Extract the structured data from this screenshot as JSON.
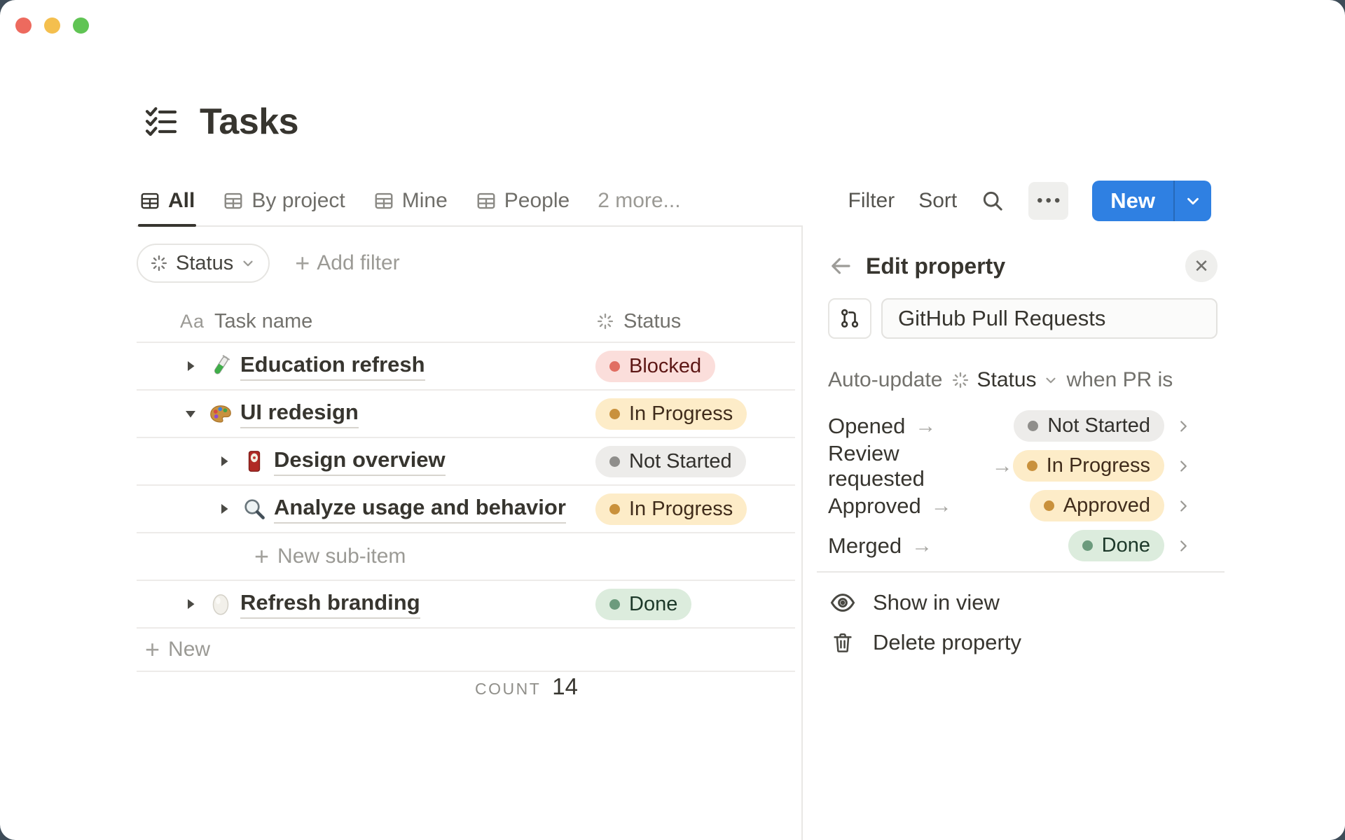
{
  "page": {
    "title": "Tasks"
  },
  "tabs": [
    {
      "label": "All",
      "active": true
    },
    {
      "label": "By project",
      "active": false
    },
    {
      "label": "Mine",
      "active": false
    },
    {
      "label": "People",
      "active": false
    }
  ],
  "tabs_more": "2 more...",
  "toolbar": {
    "filter": "Filter",
    "sort": "Sort",
    "new_label": "New"
  },
  "filter_bar": {
    "status_label": "Status",
    "add_filter_label": "Add filter"
  },
  "table": {
    "name_type_glyph": "Aa",
    "columns": {
      "name": "Task name",
      "status": "Status"
    },
    "rows": [
      {
        "title": "Education refresh",
        "status": "Blocked"
      },
      {
        "title": "UI redesign",
        "status": "In Progress"
      },
      {
        "title": "Design overview",
        "status": "Not Started"
      },
      {
        "title": "Analyze usage and behavior",
        "status": "In Progress"
      },
      {
        "title": "Refresh branding",
        "status": "Done"
      }
    ],
    "new_sub_item_label": "New sub-item",
    "new_row_label": "New",
    "count_label": "COUNT",
    "count_value": "14"
  },
  "panel": {
    "title": "Edit property",
    "property_name": "GitHub Pull Requests",
    "auto_update": {
      "prefix": "Auto-update",
      "property": "Status",
      "suffix": "when PR is"
    },
    "mappings": [
      {
        "trigger": "Opened",
        "status": "Not Started"
      },
      {
        "trigger": "Review requested",
        "status": "In Progress"
      },
      {
        "trigger": "Approved",
        "status": "Approved"
      },
      {
        "trigger": "Merged",
        "status": "Done"
      }
    ],
    "actions": {
      "show_in_view": "Show in view",
      "delete_property": "Delete property"
    }
  },
  "icons": {
    "plus": "+",
    "arrow_right": "→",
    "more": "•••",
    "close": "✕"
  },
  "colors": {
    "accent_blue": "#2f80e2",
    "window_backdrop": "#3e4c58",
    "status_blocked": {
      "bg": "#fbdedb",
      "dot": "#e16e62",
      "text": "#5d1715"
    },
    "status_in_progress": {
      "bg": "#fdecc8",
      "dot": "#c9913c",
      "text": "#402c1b"
    },
    "status_not_started": {
      "bg": "#edecea",
      "dot": "#8f8e8b",
      "text": "#32302c"
    },
    "status_done": {
      "bg": "#dcecdd",
      "dot": "#6c9b7d",
      "text": "#1c3829"
    }
  }
}
